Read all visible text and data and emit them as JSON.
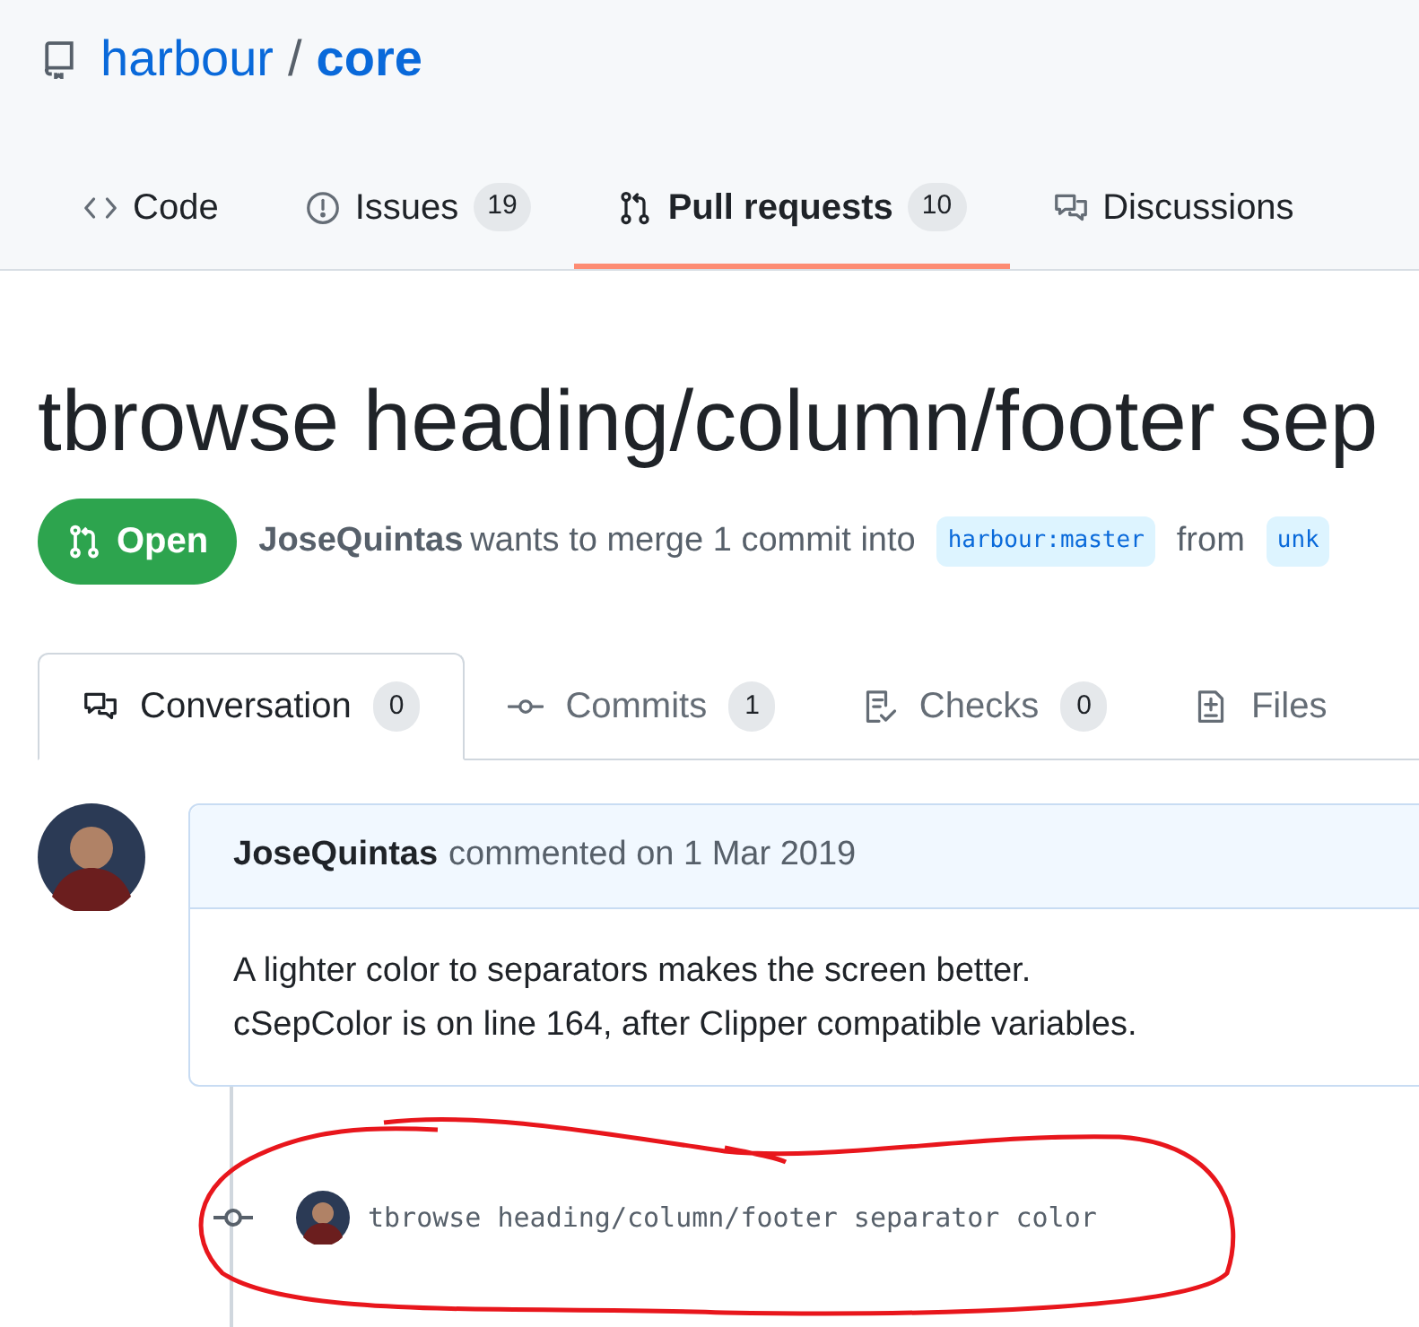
{
  "repo": {
    "owner": "harbour",
    "separator": "/",
    "name": "core"
  },
  "repo_tabs": [
    {
      "label": "Code",
      "kind": "code",
      "selected": false
    },
    {
      "label": "Issues",
      "kind": "issue",
      "count": "19",
      "selected": false
    },
    {
      "label": "Pull requests",
      "kind": "pr",
      "count": "10",
      "selected": true
    },
    {
      "label": "Discussions",
      "kind": "discussion",
      "selected": false
    }
  ],
  "pr": {
    "title": "tbrowse heading/column/footer sep",
    "state": "Open",
    "author": "JoseQuintas",
    "summary": "wants to merge 1 commit into",
    "base": "harbour:master",
    "from": "from",
    "head": "unk"
  },
  "pr_tabs": [
    {
      "label": "Conversation",
      "kind": "conversation",
      "count": "0",
      "selected": true
    },
    {
      "label": "Commits",
      "kind": "commit",
      "count": "1",
      "selected": false
    },
    {
      "label": "Checks",
      "kind": "checks",
      "count": "0",
      "selected": false
    },
    {
      "label": "Files",
      "kind": "files",
      "selected": false
    }
  ],
  "comment": {
    "author": "JoseQuintas",
    "meta": "commented on 1 Mar 2019",
    "lines": [
      "A lighter color to separators makes the screen better.",
      "cSepColor is on line 164, after Clipper compatible variables."
    ]
  },
  "commit": {
    "message": "tbrowse heading/column/footer separator color"
  }
}
